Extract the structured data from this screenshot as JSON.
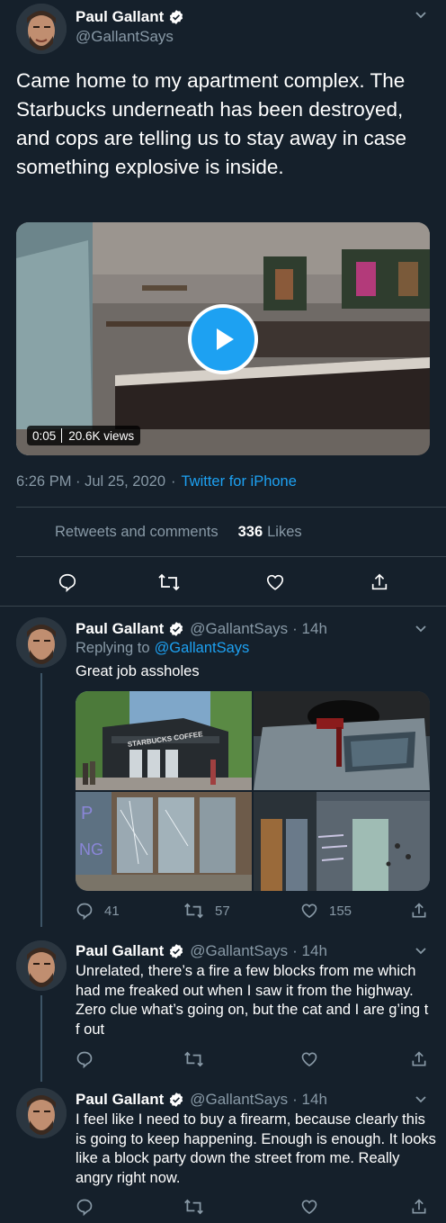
{
  "main_tweet": {
    "author_name": "Paul Gallant",
    "author_handle": "@GallantSays",
    "text": "Came home to my apartment complex. The Starbucks underneath has been destroyed, and cops are telling us to stay away in case something explosive is inside.",
    "video": {
      "duration": "0:05",
      "views": "20.6K views"
    },
    "timestamp": "6:26 PM · Jul 25, 2020",
    "dot": "·",
    "source": "Twitter for iPhone",
    "retweets_label": "Retweets and comments",
    "likes_count": "336",
    "likes_label": "Likes"
  },
  "replies": [
    {
      "author_name": "Paul Gallant",
      "author_handle": "@GallantSays",
      "time": "· 14h",
      "replying_to_label": "Replying to",
      "replying_to_handle": "@GallantSays",
      "text": "Great job assholes",
      "reply_count": "41",
      "retweet_count": "57",
      "like_count": "155"
    },
    {
      "author_name": "Paul Gallant",
      "author_handle": "@GallantSays",
      "time": "· 14h",
      "text": "Unrelated, there’s a fire a few blocks from me which had me freaked out when I saw it from the highway. Zero clue what’s going on, but the cat and I are g’ing t f out"
    },
    {
      "author_name": "Paul Gallant",
      "author_handle": "@GallantSays",
      "time": "· 14h",
      "text": "I feel like I need to buy a firearm, because clearly this is going to keep happening. Enough is enough. It looks like a block party down the street from me. Really angry right now."
    }
  ],
  "photo_signage": {
    "storefront_sign": "STARBUCKS COFFEE"
  },
  "colors": {
    "background": "#15202b",
    "accent": "#1da1f2",
    "muted": "#8899a6",
    "divider": "#38444d"
  },
  "icons": [
    "chevron-down-icon",
    "verified-badge-icon",
    "play-icon",
    "reply-icon",
    "retweet-icon",
    "like-icon",
    "share-icon"
  ]
}
